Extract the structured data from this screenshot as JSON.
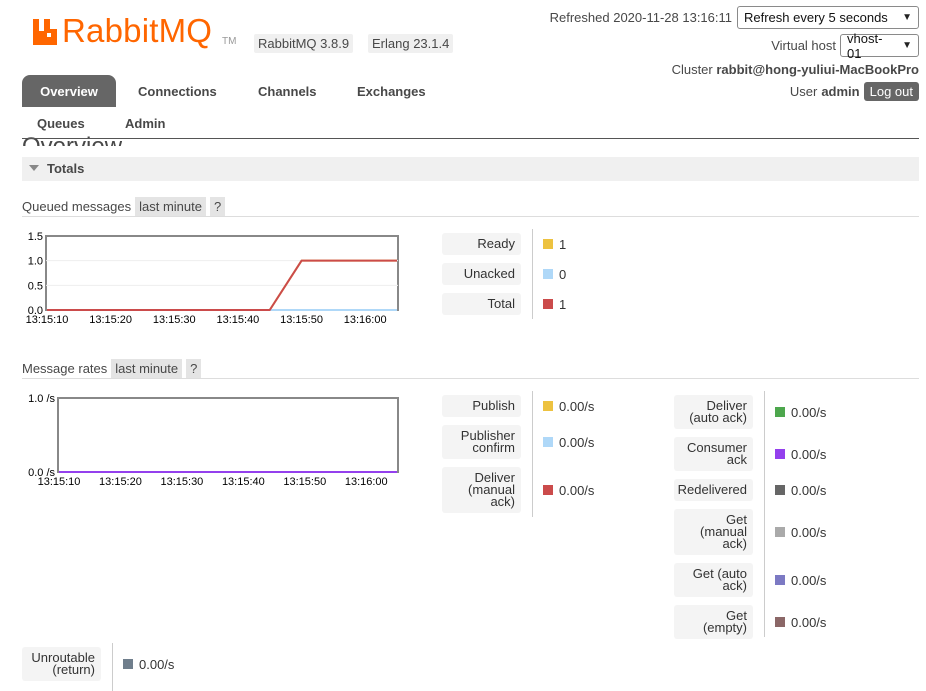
{
  "brand": {
    "name": "RabbitMQ",
    "tm": "TM",
    "color": "#ff6600"
  },
  "versions": {
    "rabbitmq": "RabbitMQ 3.8.9",
    "erlang": "Erlang 23.1.4"
  },
  "header": {
    "refreshed": "Refreshed 2020-11-28 13:16:11",
    "refresh_select": "Refresh every 5 seconds",
    "vhost_label": "Virtual host",
    "vhost_select": "vhost-01",
    "cluster_label": "Cluster",
    "cluster_name": "rabbit@hong-yuliui-MacBookPro",
    "user_label": "User",
    "user_name": "admin",
    "logout": "Log out"
  },
  "nav": {
    "tabs": [
      "Overview",
      "Connections",
      "Channels",
      "Exchanges",
      "Queues",
      "Admin"
    ],
    "active": "Overview"
  },
  "page": {
    "heading": "Overview"
  },
  "totals": {
    "label": "Totals"
  },
  "queued": {
    "title": "Queued messages",
    "range": "last minute",
    "help": "?",
    "legend": [
      {
        "label": "Ready",
        "value": "1",
        "color": "#edc240"
      },
      {
        "label": "Unacked",
        "value": "0",
        "color": "#afd8f8"
      },
      {
        "label": "Total",
        "value": "1",
        "color": "#cb4b4b"
      }
    ]
  },
  "rates": {
    "title": "Message rates",
    "range": "last minute",
    "help": "?",
    "legend_left": [
      {
        "label": "Publish",
        "value": "0.00/s",
        "color": "#edc240"
      },
      {
        "label": "Publisher confirm",
        "value": "0.00/s",
        "color": "#afd8f8"
      },
      {
        "label": "Deliver (manual ack)",
        "value": "0.00/s",
        "color": "#cb4b4b"
      }
    ],
    "legend_right": [
      {
        "label": "Deliver (auto ack)",
        "value": "0.00/s",
        "color": "#4da74d"
      },
      {
        "label": "Consumer ack",
        "value": "0.00/s",
        "color": "#9440ed"
      },
      {
        "label": "Redelivered",
        "value": "0.00/s",
        "color": "#666666"
      },
      {
        "label": "Get (manual ack)",
        "value": "0.00/s",
        "color": "#aaaaaa"
      },
      {
        "label": "Get (auto ack)",
        "value": "0.00/s",
        "color": "#7c79c3"
      },
      {
        "label": "Get (empty)",
        "value": "0.00/s",
        "color": "#8b6767"
      }
    ],
    "legend_bottom": [
      {
        "label": "Unroutable (return)",
        "value": "0.00/s",
        "color": "#6f7e8c"
      }
    ]
  },
  "chart_data": [
    {
      "type": "line",
      "x_ticks": [
        "13:15:10",
        "13:15:20",
        "13:15:30",
        "13:15:40",
        "13:15:50",
        "13:16:00"
      ],
      "y_ticks": [
        "0.0",
        "0.5",
        "1.0",
        "1.5"
      ],
      "ylim": [
        0,
        1.5
      ],
      "x": [
        "13:15:10",
        "13:15:15",
        "13:15:20",
        "13:15:25",
        "13:15:30",
        "13:15:35",
        "13:15:40",
        "13:15:45",
        "13:15:50",
        "13:15:55",
        "13:16:00",
        "13:16:05"
      ],
      "series": [
        {
          "name": "Ready",
          "color": "#edc240",
          "values": [
            0,
            0,
            0,
            0,
            0,
            0,
            0,
            0,
            1,
            1,
            1,
            1
          ]
        },
        {
          "name": "Unacked",
          "color": "#afd8f8",
          "values": [
            0,
            0,
            0,
            0,
            0,
            0,
            0,
            0,
            0,
            0,
            0,
            0
          ]
        },
        {
          "name": "Total",
          "color": "#cb4b4b",
          "values": [
            0,
            0,
            0,
            0,
            0,
            0,
            0,
            0,
            1,
            1,
            1,
            1
          ]
        }
      ]
    },
    {
      "type": "line",
      "x_ticks": [
        "13:15:10",
        "13:15:20",
        "13:15:30",
        "13:15:40",
        "13:15:50",
        "13:16:00"
      ],
      "y_ticks": [
        "0.0 /s",
        "1.0 /s"
      ],
      "ylim": [
        0,
        1
      ],
      "x": [
        "13:15:10",
        "13:15:15",
        "13:15:20",
        "13:15:25",
        "13:15:30",
        "13:15:35",
        "13:15:40",
        "13:15:45",
        "13:15:50",
        "13:15:55",
        "13:16:00",
        "13:16:05"
      ],
      "series": [
        {
          "name": "Publish",
          "color": "#edc240",
          "values": [
            0,
            0,
            0,
            0,
            0,
            0,
            0,
            0,
            0,
            0,
            0,
            0
          ]
        },
        {
          "name": "Deliver (auto ack)",
          "color": "#9440ed",
          "values": [
            0,
            0,
            0,
            0,
            0,
            0,
            0,
            0,
            0,
            0,
            0,
            0
          ]
        }
      ]
    }
  ]
}
